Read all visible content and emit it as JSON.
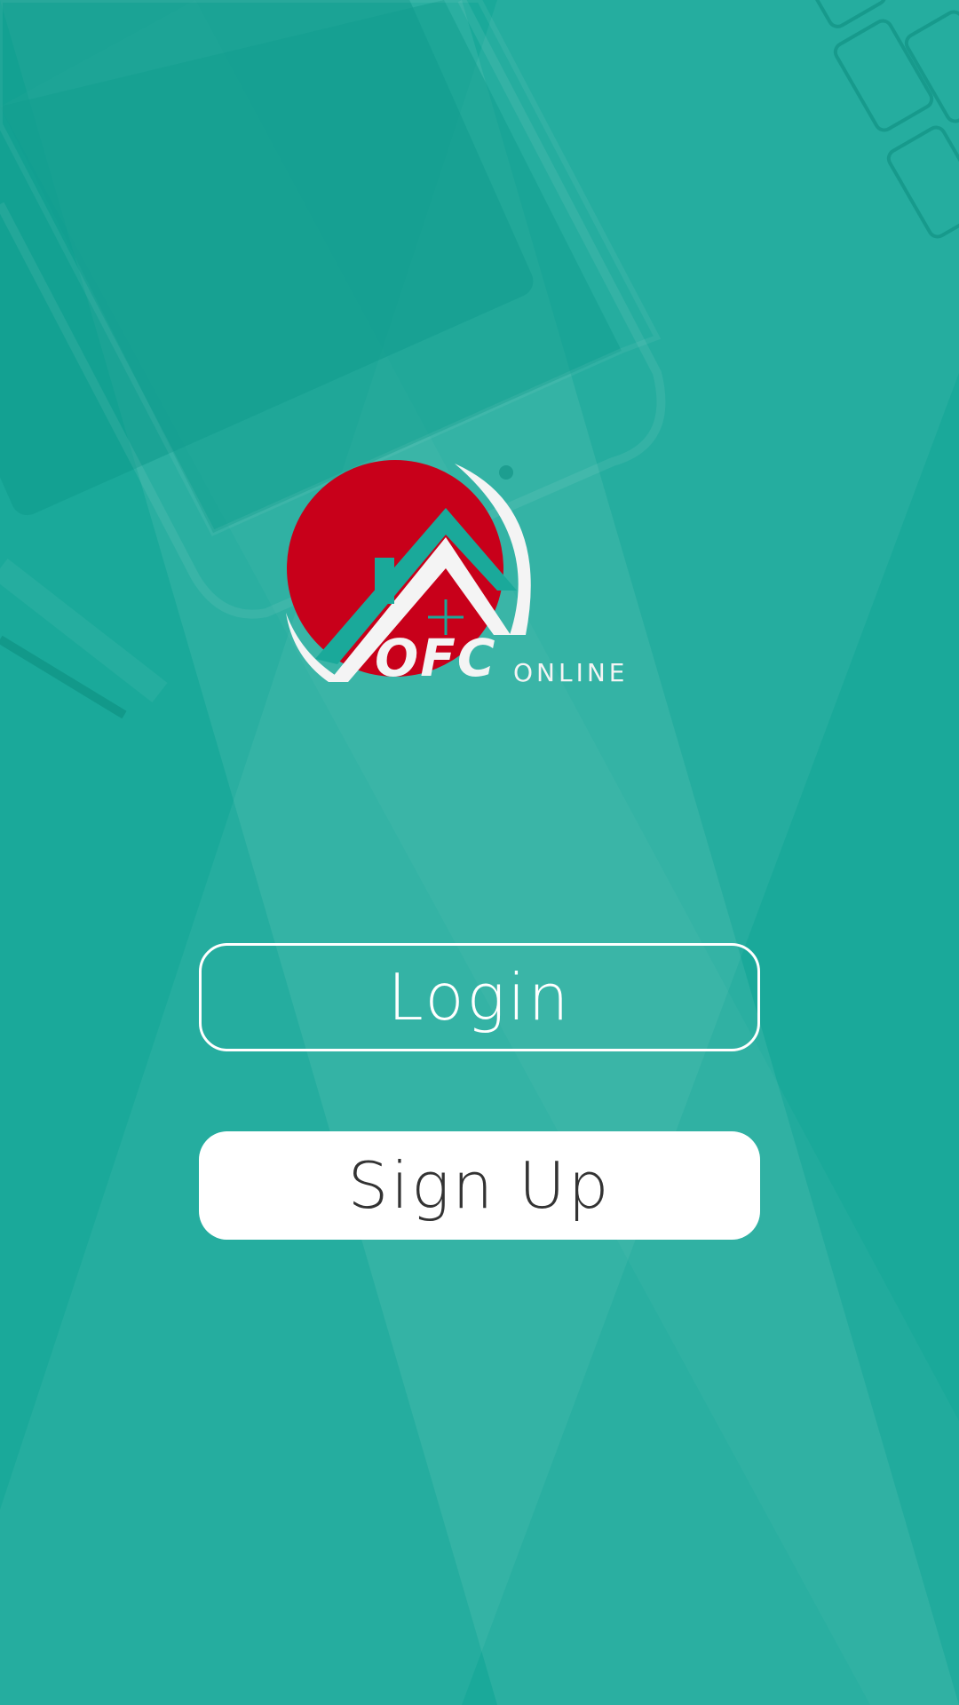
{
  "screen": {
    "background_color": "#1aa99a",
    "accent_color": "#c8001a"
  },
  "logo": {
    "brand_main": "OFC",
    "brand_sub": "ONLINE",
    "icon": "house-sun-logo-icon"
  },
  "actions": {
    "login_label": "Login",
    "signup_label": "Sign Up"
  }
}
